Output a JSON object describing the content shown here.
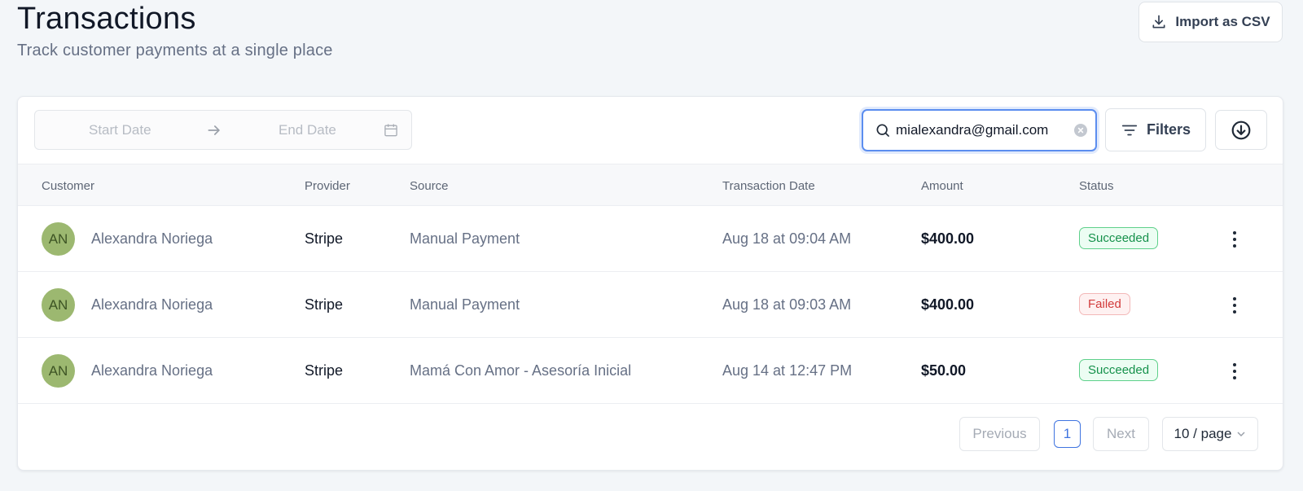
{
  "header": {
    "title": "Transactions",
    "subtitle": "Track customer payments at a single place",
    "import_label": "Import as CSV"
  },
  "toolbar": {
    "start_date_placeholder": "Start Date",
    "end_date_placeholder": "End Date",
    "search_value": "mialexandra@gmail.com",
    "filters_label": "Filters"
  },
  "table": {
    "columns": [
      "Customer",
      "Provider",
      "Source",
      "Transaction Date",
      "Amount",
      "Status"
    ],
    "rows": [
      {
        "initials": "AN",
        "customer": "Alexandra Noriega",
        "provider": "Stripe",
        "source": "Manual Payment",
        "date": "Aug 18 at 09:04 AM",
        "amount": "$400.00",
        "status": "Succeeded"
      },
      {
        "initials": "AN",
        "customer": "Alexandra Noriega",
        "provider": "Stripe",
        "source": "Manual Payment",
        "date": "Aug 18 at 09:03 AM",
        "amount": "$400.00",
        "status": "Failed"
      },
      {
        "initials": "AN",
        "customer": "Alexandra Noriega",
        "provider": "Stripe",
        "source": "Mamá Con Amor - Asesoría Inicial",
        "date": "Aug 14 at 12:47 PM",
        "amount": "$50.00",
        "status": "Succeeded"
      }
    ]
  },
  "pagination": {
    "previous_label": "Previous",
    "current_page": "1",
    "next_label": "Next",
    "per_page_label": "10 / page"
  },
  "colors": {
    "accent": "#3f74e0",
    "success": "#15914b",
    "failed": "#d23b3b",
    "avatar": "#9cb870"
  },
  "icons": {
    "import": "download-icon",
    "date_separator": "arrow-right-icon",
    "calendar": "calendar-icon",
    "search": "search-icon",
    "clear": "clear-icon",
    "filters": "filter-icon",
    "download": "download-circle-icon",
    "row_menu": "more-vertical-icon",
    "per_page": "chevron-down-icon"
  }
}
